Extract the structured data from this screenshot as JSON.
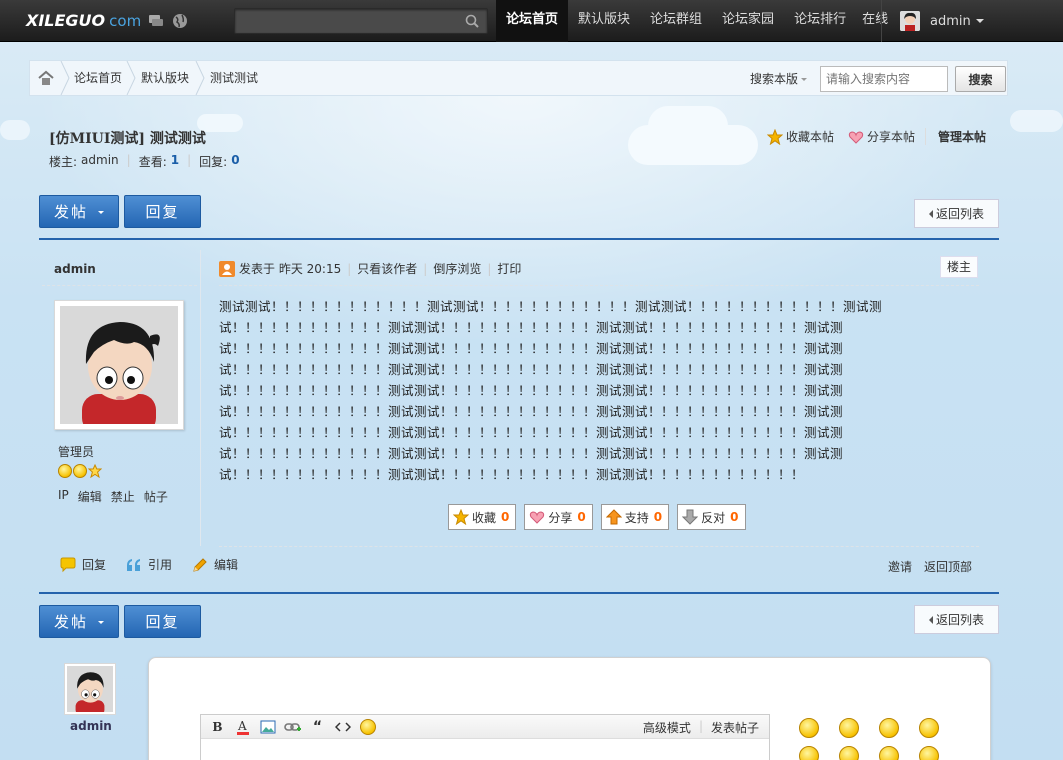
{
  "topbar": {
    "logo": "XILEGUO",
    "logo_suffix": "com",
    "search_placeholder": "",
    "nav": [
      "论坛首页",
      "默认版块",
      "论坛群组",
      "论坛家园",
      "论坛排行",
      "在线"
    ],
    "active_nav": 0,
    "username": "admin"
  },
  "breadcrumb": {
    "items": [
      "论坛首页",
      "默认版块",
      "测试测试"
    ],
    "search_scope": "搜索本版",
    "search_placeholder": "请输入搜索内容",
    "search_button": "搜索"
  },
  "thread": {
    "title": "[仿MIUI测试] 测试测试",
    "owner_label": "楼主:",
    "owner": "admin",
    "views_label": "查看:",
    "views": "1",
    "replies_label": "回复:",
    "replies": "0",
    "favorite": "收藏本帖",
    "share": "分享本帖",
    "manage": "管理本帖",
    "post_button": "发帖",
    "reply_button": "回复",
    "back_button": "返回列表"
  },
  "post": {
    "author": "admin",
    "role": "管理员",
    "admin_links": [
      "IP",
      "编辑",
      "禁止",
      "帖子"
    ],
    "posted_at": "发表于 昨天 20:15",
    "only_author": "只看该作者",
    "reverse": "倒序浏览",
    "print": "打印",
    "floor": "楼主",
    "content": "测试测试！！！！！！！！！！！！测试测试！！！！！！！！！！！！测试测试！！！！！！！！！！！！测试测试！！！！！！！！！！！！测试测试！！！！！！！！！！！！测试测试！！！！！！！！！！！！测试测试！！！！！！！！！！！！测试测试！！！！！！！！！！！！测试测试！！！！！！！！！！！！测试测试！！！！！！！！！！！！测试测试！！！！！！！！！！！！测试测试！！！！！！！！！！！！测试测试！！！！！！！！！！！！测试测试！！！！！！！！！！！！测试测试！！！！！！！！！！！！测试测试！！！！！！！！！！！！测试测试！！！！！！！！！！！！测试测试！！！！！！！！！！！！测试测试！！！！！！！！！！！！测试测试！！！！！！！！！！！！测试测试！！！！！！！！！！！！测试测试！！！！！！！！！！！！测试测试！！！！！！！！！！！！测试测试！！！！！！！！！！！！测试测试！！！！！！！！！！！！测试测试！！！！！！！！！！！！测试测试！！！！！！！！！！！！",
    "actions": [
      {
        "label": "收藏",
        "count": "0"
      },
      {
        "label": "分享",
        "count": "0"
      },
      {
        "label": "支持",
        "count": "0"
      },
      {
        "label": "反对",
        "count": "0"
      }
    ],
    "foot_reply": "回复",
    "foot_quote": "引用",
    "foot_edit": "编辑",
    "invite": "邀请",
    "back_top": "返回顶部"
  },
  "reply": {
    "username": "admin",
    "advanced_mode": "高级模式",
    "post_thread": "发表帖子"
  }
}
